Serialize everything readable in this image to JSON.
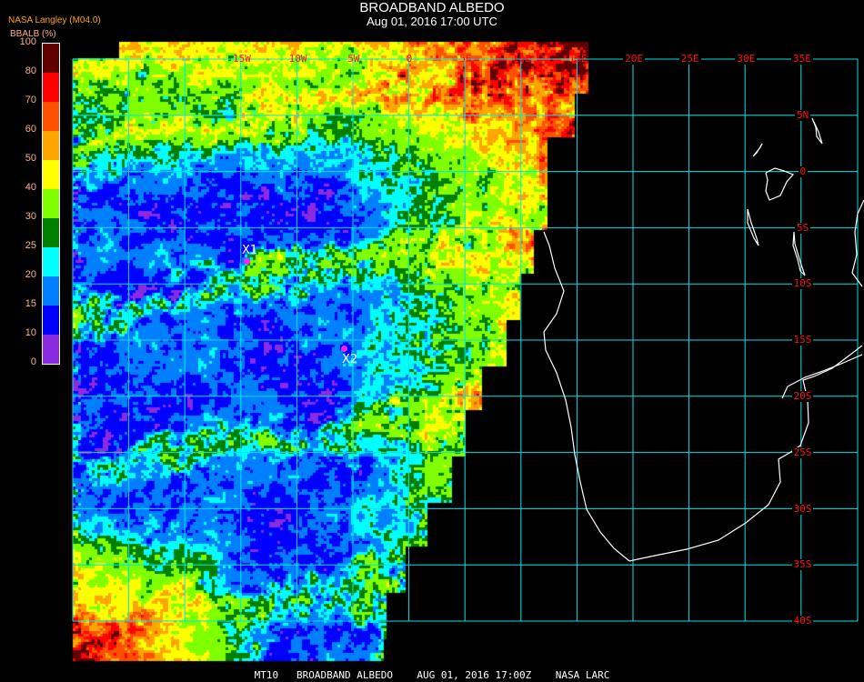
{
  "header": {
    "title": "BROADBAND ALBEDO",
    "subtitle": "Aug 01, 2016 17:00 UTC",
    "organization": "NASA Langley (M04.0)"
  },
  "legend": {
    "unit_label": "BBALB (%)",
    "ticks": [
      "0",
      "10",
      "15",
      "20",
      "25",
      "30",
      "40",
      "50",
      "60",
      "70",
      "80",
      "100"
    ],
    "colors": [
      "#8a2be2",
      "#0000ff",
      "#0080ff",
      "#00ffff",
      "#008000",
      "#80ff00",
      "#ffff00",
      "#ffa500",
      "#ff5000",
      "#ff0000",
      "#600000"
    ]
  },
  "map": {
    "longitude_labels": [
      "15W",
      "10W",
      "5W",
      "0",
      "5E",
      "10E",
      "15E",
      "20E",
      "25E",
      "30E",
      "35E"
    ],
    "latitude_labels": [
      "5N",
      "0",
      "5S",
      "10S",
      "15S",
      "20S",
      "25S",
      "30S",
      "35S",
      "40S"
    ],
    "grid_color": "#00e5ee",
    "label_color": "#ff1010",
    "markers": [
      {
        "label": "X1",
        "color": "#ff20ff"
      },
      {
        "label": "X2",
        "color": "#ff20ff"
      }
    ]
  },
  "footer": {
    "text": "MT10   BROADBAND ALBEDO    AUG 01, 2016 17:00Z    NASA LARC"
  }
}
